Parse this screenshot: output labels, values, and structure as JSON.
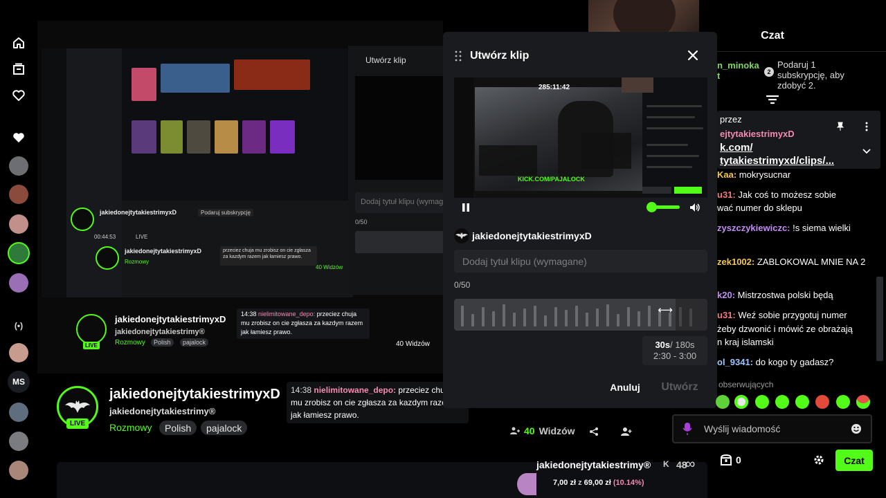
{
  "sidebar": {
    "items": [
      {
        "name": "home",
        "icon": "home-icon"
      },
      {
        "name": "browse",
        "icon": "browse-icon"
      },
      {
        "name": "following",
        "icon": "heart-outline-icon"
      }
    ],
    "followed_heart": "heart-filled-icon",
    "channel_avatars": [
      {
        "colors": "#6c6e72"
      },
      {
        "colors": "#8a4a3c"
      },
      {
        "colors": "#c28f8a"
      },
      {
        "colors": "#2f7a3a"
      },
      {
        "colors": "#9a6fb5"
      }
    ],
    "more_icon": "(•)",
    "bottom_avatars": [
      {
        "color": "#c79b8e"
      },
      {
        "color": "#5e6e7e"
      },
      {
        "color": "#7a7c80"
      },
      {
        "color": "#a8877a"
      }
    ],
    "ms_label": "MS"
  },
  "background": {
    "clip_title": "Utwórz klip",
    "clip_placeholder": "Dodaj tytuł klipu (wymagane",
    "clip_count": "0/50",
    "channel_name": "jakiedonejtytakiestrimyxD",
    "channel_sub": "jakiedonejtytakiestrimy®",
    "category": "Rozmowy",
    "tags": [
      "Polish",
      "pajalock"
    ],
    "live": "LIVE",
    "pinned_time": "14:38",
    "pinned_user": "nielimitowane_depo:",
    "pinned_text": "przeciez chuja mu zrobisz on cie zgłasza za kazdym razem jak łamiesz prawo.",
    "viewers": "40 Widzów",
    "time": "00:44:53",
    "live_small": "LIVE",
    "subscribe": "Podaruj subskrypcję"
  },
  "stream": {
    "channel_name": "jakiedonejtytakiestrimyxD",
    "channel_sub": "jakiedonejtytakiestrimy®",
    "live_label": "LIVE",
    "category": "Rozmowy",
    "tags": [
      "Polish",
      "pajalock"
    ],
    "pinned": {
      "time": "14:38",
      "user": "nielimitowane_depo:",
      "text": "przeciez chuja mu zrobisz on cie zgłasza za kazdym razem jak łamiesz prawo."
    },
    "viewers_count": "40",
    "viewers_label": "Widzów"
  },
  "goal": {
    "name": "jakiedonejtytakiestrimy®",
    "k_label": "K",
    "count": "48",
    "current": "7,00 zł",
    "of_label": "z",
    "target": "69,00 zł",
    "percent": "(10.14%)",
    "fraction": 0.1014
  },
  "clip_modal": {
    "title": "Utwórz klip",
    "video_timer": "285:11:42",
    "video_overlay": "KICK.COM/PAJALOCK",
    "channel": "jakiedonejtytakiestrimyxD",
    "title_placeholder": "Dodaj tytuł klipu (wymagane)",
    "char_count": "0/50",
    "duration_selected": "30s",
    "duration_max": "/ 180s",
    "range": "2:30 - 3:00",
    "cancel_label": "Anuluj",
    "create_label": "Utwórz",
    "volume_fraction": 0.0,
    "accent": "#53fc18"
  },
  "chat": {
    "title": "Czat",
    "gift_user": "n_minoka",
    "gift_user_line2": "t",
    "gift_num": "2",
    "gift_text": "Podaruj 1 subskrypcję, aby zdobyć 2.",
    "pinned": {
      "label": "przez",
      "user": "ejtytakiestrimyxD",
      "link1": "k.com/",
      "link2": "tytakiestrimyxd/clips/..."
    },
    "messages": [
      {
        "user": "Kaa:",
        "text": " mokrysucnar",
        "color": "#f3c74a"
      },
      {
        "user": "u31:",
        "text": " Jak coś to możesz sobie",
        "color": "#f07b7b"
      },
      {
        "user": "",
        "text": "wać numer do sklepu",
        "color": "#ffffff"
      },
      {
        "user": "zyszczykiewiczc:",
        "text": " !s siema wielki",
        "color": "#c48cf5"
      },
      {
        "user": "zek1002:",
        "text": " ZABLOKOWAL MNIE NA 2",
        "color": "#f3c74a"
      },
      {
        "user": "k20:",
        "text": " Mistrzostwa polski będą",
        "color": "#c48cf5"
      },
      {
        "user": "u31:",
        "text": " Weź sobie przygotuj numer",
        "color": "#f07b7b"
      },
      {
        "user": "",
        "text": "żeby dzwonić i mówić ze obrażają",
        "color": "#ffffff"
      },
      {
        "user": "",
        "text": "n kraj islamski",
        "color": "#ffffff"
      },
      {
        "user": "ol_9341:",
        "text": " do kogo ty gadasz?",
        "color": "#9ec6ff"
      }
    ],
    "observers_label": "obserwujących",
    "input_placeholder": "Wyślij wiadomość",
    "box_count": "0",
    "chat_button": "Czat"
  }
}
